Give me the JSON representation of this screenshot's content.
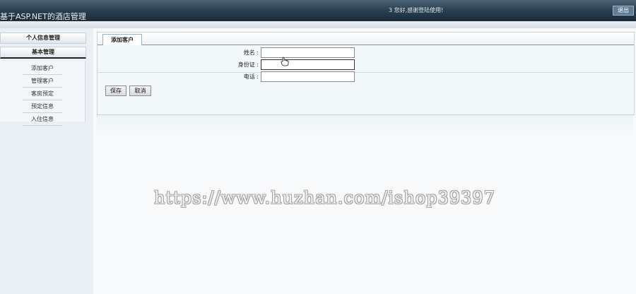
{
  "header": {
    "app_title": "基于ASP.NET的酒店管理",
    "welcome": "3 您好,感谢登陆使用!",
    "logout_label": "退出"
  },
  "sidebar": {
    "section_personal": "个人信息管理",
    "section_basic": "基本管理",
    "items": [
      {
        "label": "添加客户"
      },
      {
        "label": "管理客户"
      },
      {
        "label": "客房预定"
      },
      {
        "label": "预定信息"
      },
      {
        "label": "入住信息"
      }
    ]
  },
  "main": {
    "tab_label": "添加客户",
    "form": {
      "name_label": "姓名 :",
      "name_value": "",
      "idcard_label": "身份证 :",
      "idcard_value": "",
      "phone_label": "电话 :",
      "phone_value": ""
    },
    "save_label": "保存",
    "cancel_label": "取消"
  },
  "watermark": "https://www.huzhan.com/ishop39397",
  "colors": {
    "header_dark": "#1a2b39",
    "sidebar_bg": "#e9eff4",
    "content_bg": "#f2f8f9"
  }
}
